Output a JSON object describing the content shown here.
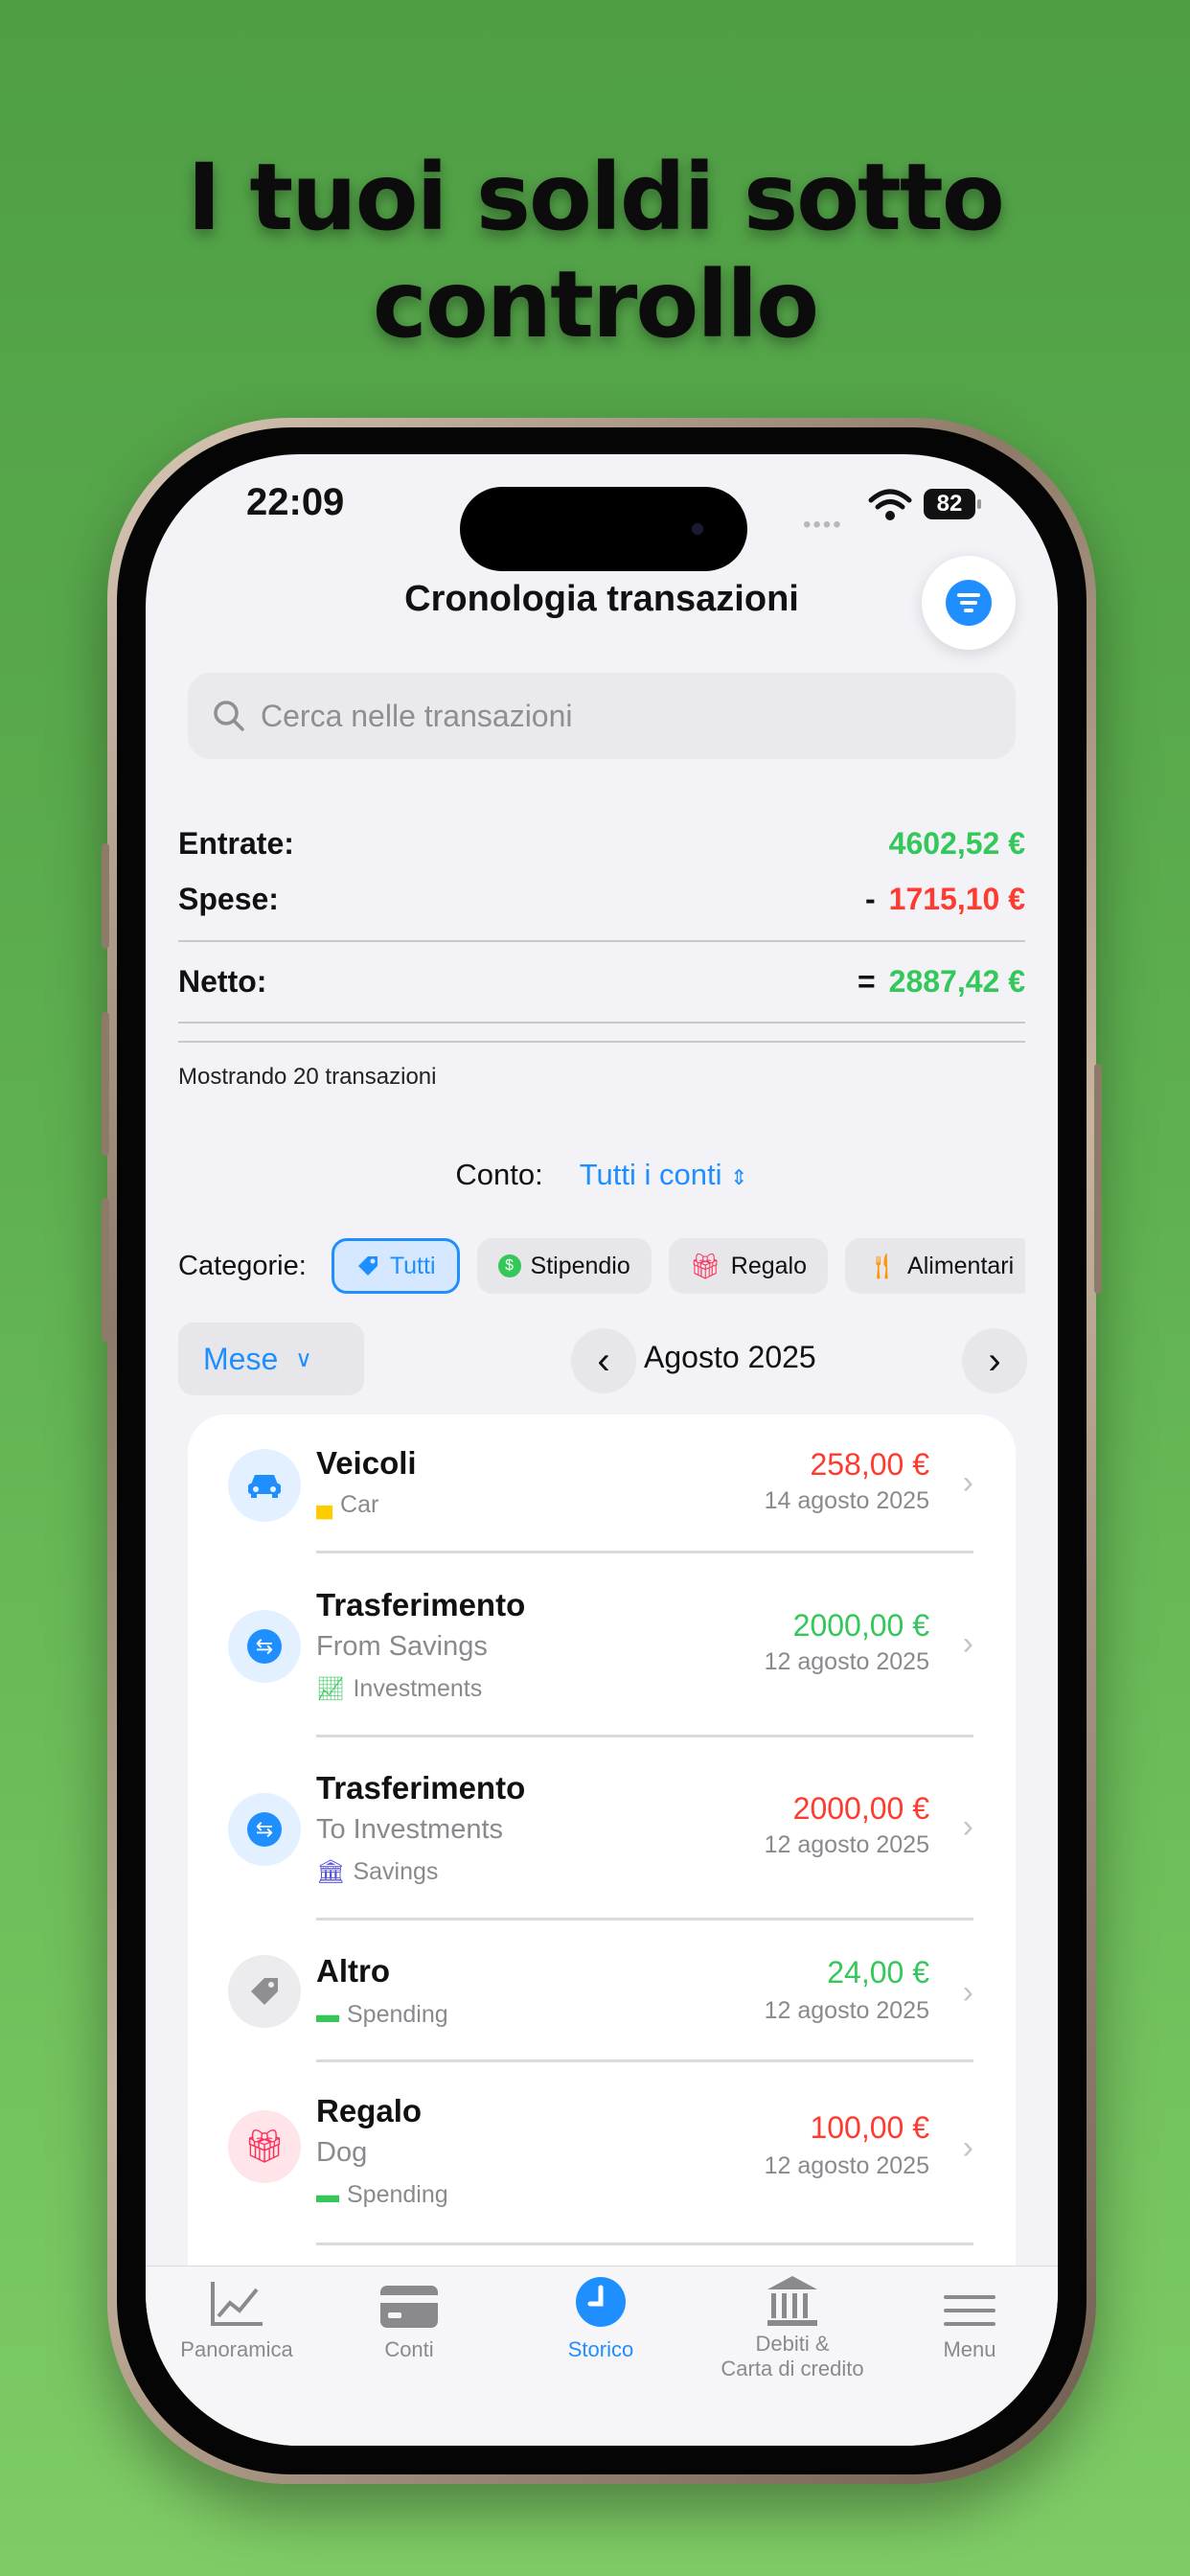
{
  "headline": "I tuoi soldi sotto controllo",
  "status": {
    "time": "22:09",
    "battery": "82"
  },
  "header": {
    "title": "Cronologia transazioni"
  },
  "search": {
    "placeholder": "Cerca nelle transazioni"
  },
  "summary": {
    "income_label": "Entrate:",
    "income_value": "4602,52 €",
    "expense_label": "Spese:",
    "expense_sign": "-",
    "expense_value": "1715,10 €",
    "net_label": "Netto:",
    "net_sign": "=",
    "net_value": "2887,42 €",
    "showing": "Mostrando 20 transazioni"
  },
  "account": {
    "label": "Conto:",
    "value": "Tutti i conti"
  },
  "categories": {
    "label": "Categorie:",
    "chips": [
      {
        "label": "Tutti",
        "icon": "tag-icon"
      },
      {
        "label": "Stipendio",
        "icon": "dollar-icon"
      },
      {
        "label": "Regalo",
        "icon": "gift-icon"
      },
      {
        "label": "Alimentari",
        "icon": "fork-knife-icon"
      }
    ]
  },
  "period": {
    "mode": "Mese",
    "month": "Agosto 2025"
  },
  "transactions": [
    {
      "title": "Veicoli",
      "subtitle": "",
      "account": "Car",
      "amount": "258,00 €",
      "date": "14 agosto 2025",
      "type": "expense",
      "icon": "car-icon"
    },
    {
      "title": "Trasferimento",
      "subtitle": "From Savings",
      "account": "Investments",
      "amount": "2000,00 €",
      "date": "12 agosto 2025",
      "type": "income",
      "icon": "transfer-icon"
    },
    {
      "title": "Trasferimento",
      "subtitle": "To Investments",
      "account": "Savings",
      "amount": "2000,00 €",
      "date": "12 agosto 2025",
      "type": "expense",
      "icon": "transfer-icon"
    },
    {
      "title": "Altro",
      "subtitle": "",
      "account": "Spending",
      "amount": "24,00 €",
      "date": "12 agosto 2025",
      "type": "income",
      "icon": "tag-icon"
    },
    {
      "title": "Regalo",
      "subtitle": "Dog",
      "account": "Spending",
      "amount": "100,00 €",
      "date": "12 agosto 2025",
      "type": "expense",
      "icon": "gift-icon"
    }
  ],
  "tabs": {
    "overview": "Panoramica",
    "accounts": "Conti",
    "history": "Storico",
    "debts_line1": "Debiti &",
    "debts_line2": "Carta di credito",
    "menu": "Menu"
  },
  "colors": {
    "accent": "#1f8fff",
    "income": "#34c759",
    "expense": "#ff3b30",
    "background": "#5fb050"
  }
}
